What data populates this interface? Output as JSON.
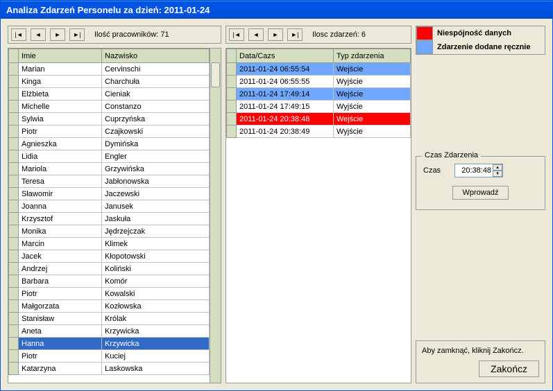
{
  "window_title": "Analiza Zdarzeń Personelu za dzień: 2011-01-24",
  "employees": {
    "count_label": "Ilość pracowników: 71",
    "col1": "Imie",
    "col2": "Nazwisko",
    "rows": [
      {
        "first": "Marian",
        "last": "Cervinschi"
      },
      {
        "first": "Kinga",
        "last": "Charchuła"
      },
      {
        "first": "Elżbieta",
        "last": "Cieniak"
      },
      {
        "first": "Michelle",
        "last": "Constanzo"
      },
      {
        "first": "Sylwia",
        "last": "Cuprzyńska"
      },
      {
        "first": "Piotr",
        "last": "Czajkowski"
      },
      {
        "first": "Agnieszka",
        "last": "Dymińska"
      },
      {
        "first": "Lidia",
        "last": "Engler"
      },
      {
        "first": "Mariola",
        "last": "Grzywińska"
      },
      {
        "first": "Teresa",
        "last": "Jabłonowska"
      },
      {
        "first": "Sławomir",
        "last": "Jaczewski"
      },
      {
        "first": "Joanna",
        "last": "Janusek"
      },
      {
        "first": "Krzysztof",
        "last": "Jaskuła"
      },
      {
        "first": "Monika",
        "last": "Jędrzejczak"
      },
      {
        "first": "Marcin",
        "last": "Klimek"
      },
      {
        "first": "Jacek",
        "last": "Kłopotowski"
      },
      {
        "first": "Andrzej",
        "last": "Koliński"
      },
      {
        "first": "Barbara",
        "last": "Komór"
      },
      {
        "first": "Piotr",
        "last": "Kowalski"
      },
      {
        "first": "Małgorzata",
        "last": "Kozłowska"
      },
      {
        "first": "Stanisław",
        "last": "Królak"
      },
      {
        "first": "Aneta",
        "last": "Krzywicka"
      },
      {
        "first": "Hanna",
        "last": "Krzywicka",
        "sel": true
      },
      {
        "first": "Piotr",
        "last": "Kuciej"
      },
      {
        "first": "Katarzyna",
        "last": "Laskowska"
      }
    ]
  },
  "events": {
    "count_label": "Ilosc zdarzeń: 6",
    "col1": "Data/Cazs",
    "col2": "Typ zdarzenia",
    "rows": [
      {
        "dt": "2011-01-24 06:55:54",
        "type": "Wejście",
        "cls": "manual"
      },
      {
        "dt": "2011-01-24 06:55:55",
        "type": "Wyjście"
      },
      {
        "dt": "2011-01-24 17:49:14",
        "type": "Wejście",
        "cls": "manual"
      },
      {
        "dt": "2011-01-24 17:49:15",
        "type": "Wyjście"
      },
      {
        "dt": "2011-01-24 20:38:48",
        "type": "Wejście",
        "cls": "conflict"
      },
      {
        "dt": "2011-01-24 20:38:49",
        "type": "Wyjście"
      }
    ]
  },
  "legend": {
    "red": "Niespójność danych",
    "blue": "Zdarzenie dodane ręcznie"
  },
  "time_group": {
    "title": "Czas Zdarzenia",
    "label": "Czas",
    "value": "20:38:48",
    "apply": "Wprowadź"
  },
  "footer": {
    "hint": "Aby zamknąć, kliknij Zakończ.",
    "close": "Zakończ"
  }
}
